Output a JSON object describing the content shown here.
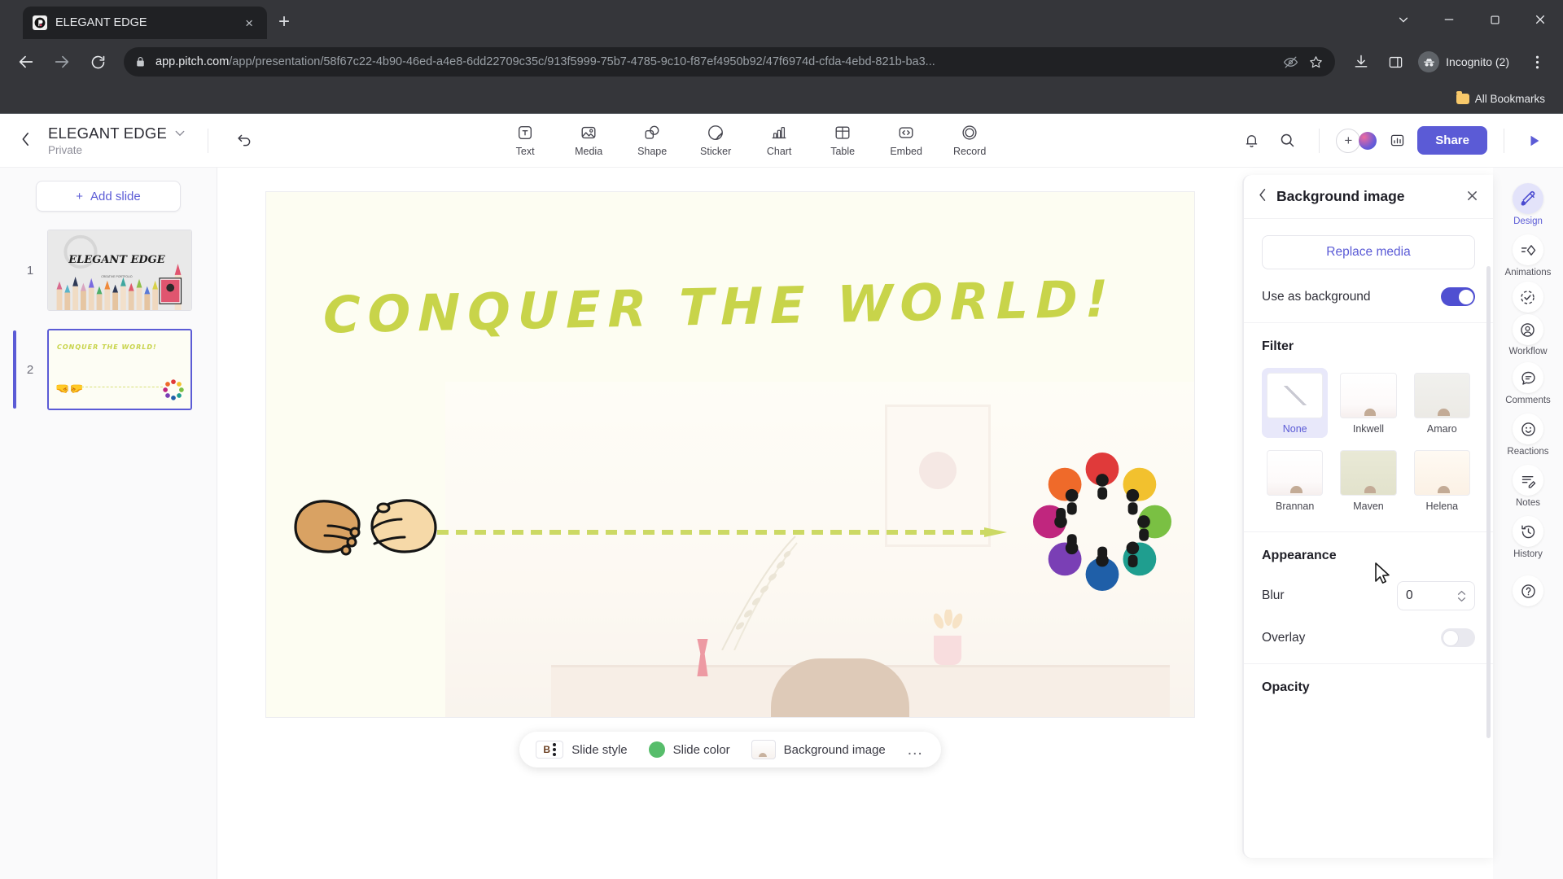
{
  "browser": {
    "tab": {
      "title": "ELEGANT EDGE",
      "favicon_letter": "P",
      "close_label": "×"
    },
    "new_tab_label": "+",
    "window_controls": {
      "minimize": "–",
      "maximize": "□",
      "close": "✕",
      "chevron": "∨"
    },
    "nav": {
      "back": "←",
      "forward": "→",
      "reload": "⟳"
    },
    "omnibox": {
      "lock_icon": "lock-icon",
      "url_domain": "app.pitch.com",
      "url_path": "/app/presentation/58f67c22-4b90-46ed-a4e8-6dd22709c35c/913f5999-75b7-4785-9c10-f87ef4950b92/47f6974d-cfda-4ebd-821b-ba3...",
      "tracking_icon": "eye-off-icon",
      "bookmark_icon": "star-icon"
    },
    "toolbar_right": {
      "download_icon": "download-icon",
      "sidepanel_icon": "side-panel-icon",
      "profile_label": "Incognito (2)",
      "menu_icon": "three-dot-menu-icon"
    },
    "bookmarks_bar": {
      "all_bookmarks_label": "All Bookmarks"
    }
  },
  "app": {
    "header": {
      "back_icon": "chevron-left-icon",
      "deck_title": "ELEGANT EDGE",
      "deck_visibility": "Private",
      "title_caret": "∨",
      "undo_icon": "undo-icon",
      "tools": [
        {
          "label": "Text",
          "icon": "text-icon"
        },
        {
          "label": "Media",
          "icon": "media-icon"
        },
        {
          "label": "Shape",
          "icon": "shape-icon"
        },
        {
          "label": "Sticker",
          "icon": "sticker-icon"
        },
        {
          "label": "Chart",
          "icon": "chart-icon"
        },
        {
          "label": "Table",
          "icon": "table-icon"
        },
        {
          "label": "Embed",
          "icon": "embed-icon"
        },
        {
          "label": "Record",
          "icon": "record-icon"
        }
      ],
      "notifications_icon": "bell-icon",
      "search_icon": "search-icon",
      "add_people_icon": "plus-circle-icon",
      "analytics_icon": "analytics-icon",
      "share_label": "Share",
      "present_icon": "play-icon"
    },
    "slides_pane": {
      "add_slide_label": "Add slide",
      "add_slide_plus": "+",
      "slides": [
        {
          "number": "1",
          "title": "ELEGANT EDGE",
          "subtitle": "CREATIVE PORTFOLIO",
          "selected": false
        },
        {
          "number": "2",
          "title": "CONQUER THE WORLD!",
          "selected": true
        }
      ]
    },
    "canvas": {
      "slide_title": "CONQUER THE WORLD!",
      "title_color": "#c8d44a",
      "slide_bg": "#fdfdf2",
      "hand_left_emoji": "🤜",
      "hand_right_emoji": "🤛",
      "dashed_arrow_color": "#ccd964"
    },
    "style_bar": {
      "slide_style_label": "Slide style",
      "slide_style_icon": "bold-text-icon",
      "slide_color_label": "Slide color",
      "slide_color_swatch": "#57bd6b",
      "background_image_label": "Background image",
      "more_label": "…"
    },
    "properties": {
      "back_icon": "chevron-left-icon",
      "title": "Background image",
      "close_icon": "close-icon",
      "replace_media_label": "Replace media",
      "use_as_background_label": "Use as background",
      "use_as_background_on": true,
      "filter_section_title": "Filter",
      "filters": [
        {
          "name": "None",
          "selected": true
        },
        {
          "name": "Inkwell",
          "selected": false
        },
        {
          "name": "Amaro",
          "selected": false
        },
        {
          "name": "Brannan",
          "selected": false
        },
        {
          "name": "Maven",
          "selected": false
        },
        {
          "name": "Helena",
          "selected": false
        }
      ],
      "appearance_section_title": "Appearance",
      "blur_label": "Blur",
      "blur_value": "0",
      "overlay_label": "Overlay",
      "overlay_on": false,
      "opacity_section_title": "Opacity"
    },
    "rail": [
      {
        "label": "Design",
        "icon": "design-brush-icon",
        "active": true
      },
      {
        "label": "Animations",
        "icon": "animations-icon",
        "active": false
      },
      {
        "label": "Workflow",
        "icon": "workflow-icon",
        "active": false
      },
      {
        "label": "Comments",
        "icon": "comment-icon",
        "active": false
      },
      {
        "label": "Reactions",
        "icon": "smiley-icon",
        "active": false
      },
      {
        "label": "Notes",
        "icon": "notes-icon",
        "active": false
      },
      {
        "label": "History",
        "icon": "history-clock-icon",
        "active": false
      }
    ],
    "rail_help_icon": "help-circle-icon",
    "accent_color": "#5b5bd6"
  }
}
